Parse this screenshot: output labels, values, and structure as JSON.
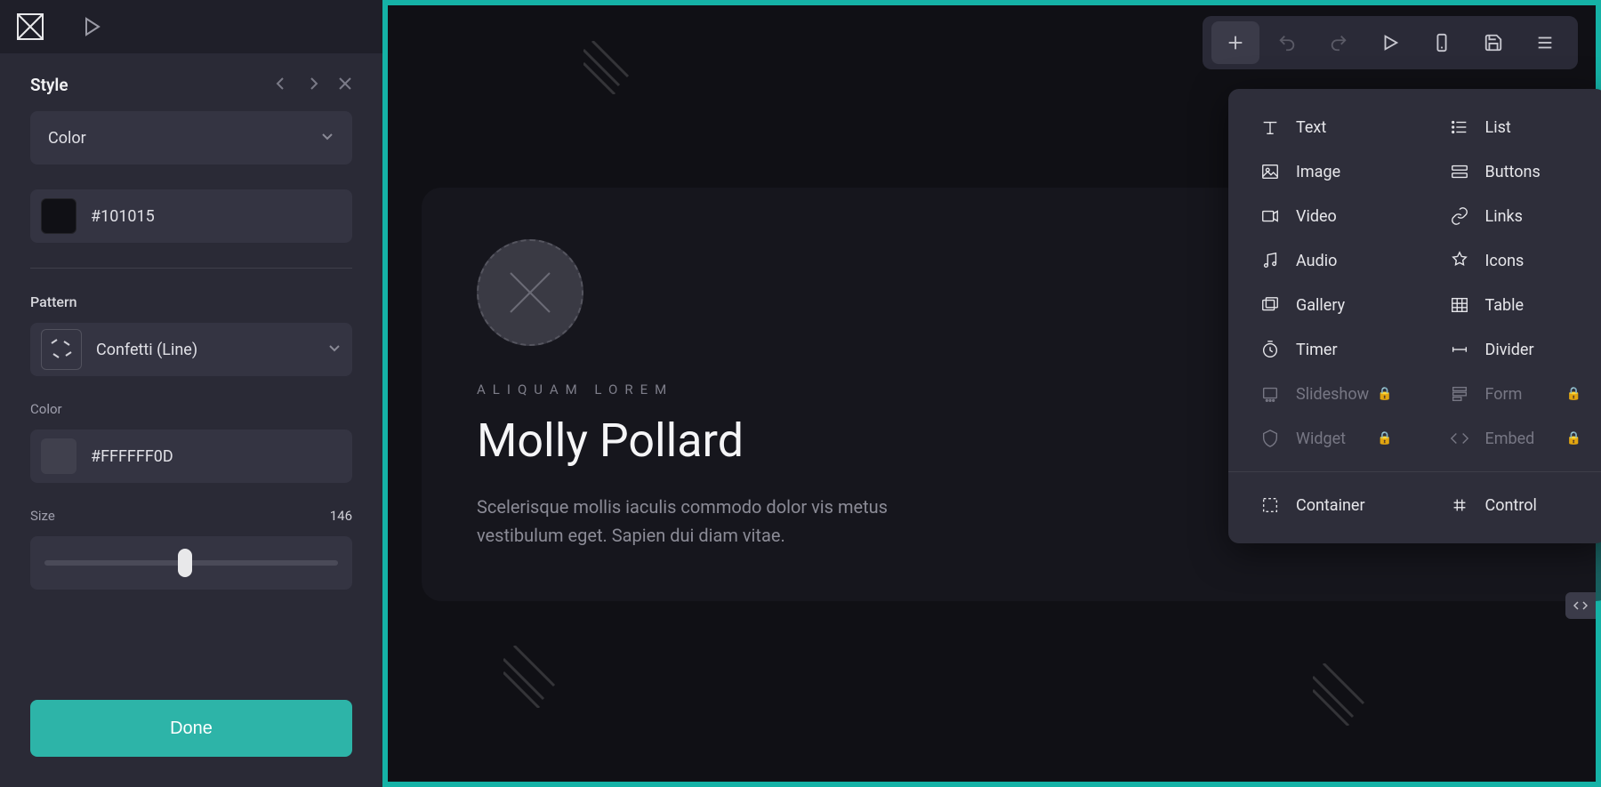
{
  "sidebar": {
    "title": "Style",
    "style_select": {
      "label": "Color"
    },
    "style_color": {
      "hex": "#101015"
    },
    "pattern_title": "Pattern",
    "pattern_select": {
      "label": "Confetti (Line)"
    },
    "pattern_color_label": "Color",
    "pattern_color": {
      "hex": "#FFFFFF0D"
    },
    "size_label": "Size",
    "size_value": "146",
    "slider_percent": 48,
    "done_label": "Done"
  },
  "toolbar": {
    "icons": [
      "plus",
      "undo",
      "redo",
      "play",
      "mobile",
      "save",
      "menu"
    ]
  },
  "popover": {
    "col1": [
      {
        "name": "text",
        "label": "Text",
        "locked": false
      },
      {
        "name": "image",
        "label": "Image",
        "locked": false
      },
      {
        "name": "video",
        "label": "Video",
        "locked": false
      },
      {
        "name": "audio",
        "label": "Audio",
        "locked": false
      },
      {
        "name": "gallery",
        "label": "Gallery",
        "locked": false
      },
      {
        "name": "timer",
        "label": "Timer",
        "locked": false
      },
      {
        "name": "slideshow",
        "label": "Slideshow",
        "locked": true
      },
      {
        "name": "widget",
        "label": "Widget",
        "locked": true
      }
    ],
    "col2": [
      {
        "name": "list",
        "label": "List",
        "locked": false
      },
      {
        "name": "buttons",
        "label": "Buttons",
        "locked": false
      },
      {
        "name": "links",
        "label": "Links",
        "locked": false
      },
      {
        "name": "icons",
        "label": "Icons",
        "locked": false
      },
      {
        "name": "table",
        "label": "Table",
        "locked": false
      },
      {
        "name": "divider",
        "label": "Divider",
        "locked": false
      },
      {
        "name": "form",
        "label": "Form",
        "locked": true
      },
      {
        "name": "embed",
        "label": "Embed",
        "locked": true
      }
    ],
    "footer": [
      {
        "name": "container",
        "label": "Container"
      },
      {
        "name": "control",
        "label": "Control"
      }
    ]
  },
  "canvas": {
    "eyebrow": "ALIQUAM LOREM",
    "headline": "Molly Pollard",
    "body": "Scelerisque mollis iaculis commodo dolor vis metus vestibulum eget. Sapien dui diam vitae."
  },
  "colors": {
    "accent": "#2db4a8",
    "frame": "#15b2a6"
  }
}
